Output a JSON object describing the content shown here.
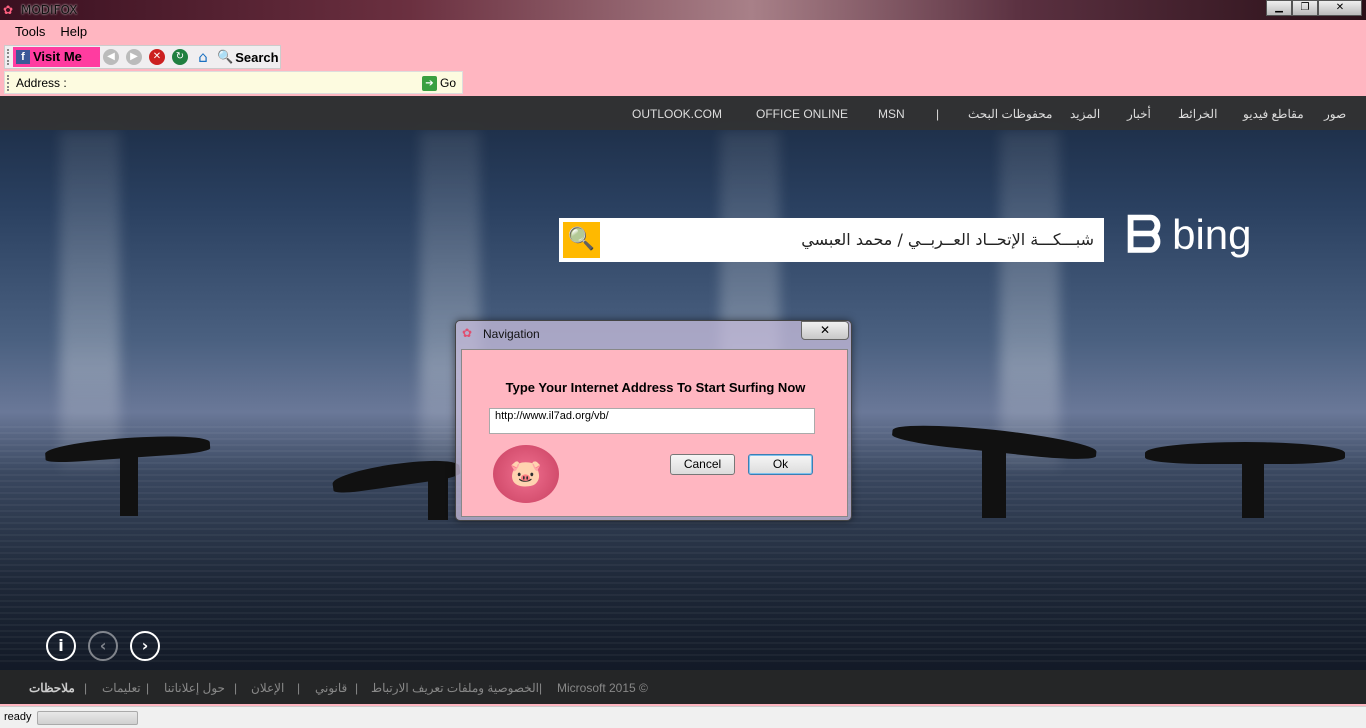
{
  "window": {
    "title": "MODIFOX",
    "minimize": "▁",
    "restore": "❐",
    "close": "✕"
  },
  "menubar": {
    "items": [
      "Tools",
      "Help"
    ]
  },
  "toolbar": {
    "visit_label": "Visit Me",
    "fb_glyph": "f",
    "back_glyph": "◀",
    "forward_glyph": "▶",
    "stop_glyph": "✕",
    "refresh_glyph": "↻",
    "home_glyph": "⌂",
    "search_glyph": "🔍",
    "search_label": "Search"
  },
  "address_bar": {
    "label": "Address :",
    "value": "",
    "go_label": "Go",
    "go_glyph": "➔"
  },
  "bing": {
    "nav": [
      "صور",
      "مقاطع فيديو",
      "الخرائط",
      "أخبار",
      "المزيد",
      "محفوظات البحث",
      "|",
      "MSN",
      "OFFICE ONLINE",
      "OUTLOOK.COM"
    ],
    "search_query": "شبـــكـــة الإتحــاد العــربــي / محمد العبسي",
    "logo_word": "bing",
    "info_glyph": "i",
    "prev_glyph": "‹",
    "next_glyph": "›",
    "footer": [
      "ملاحظات",
      "|",
      "تعليمات",
      "|",
      "حول إعلاناتنا",
      "|",
      "الإعلان",
      "|",
      "قانوني",
      "|",
      "الخصوصية وملفات تعريف الارتباط",
      "|",
      "Microsoft 2015 ©"
    ]
  },
  "status": {
    "text": "ready"
  },
  "dialog": {
    "title": "Navigation",
    "close_glyph": "✕",
    "heading": "Type Your Internet Address To Start Surfing Now",
    "url_value": "http://www.il7ad.org/vb/",
    "cancel_label": "Cancel",
    "ok_label": "Ok"
  },
  "colors": {
    "chrome_pink": "#ffb6c1",
    "visit_pink": "#ff3ca0",
    "bing_yellow": "#ffb900",
    "address_bg": "#fdfbe0"
  }
}
